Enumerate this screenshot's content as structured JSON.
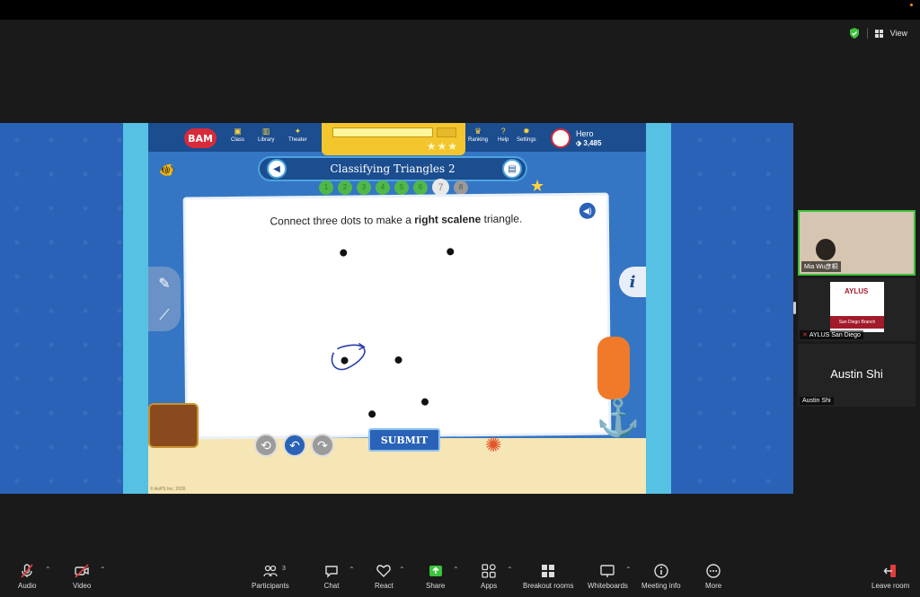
{
  "window": {
    "view_label": "View"
  },
  "game": {
    "logo": "BAM",
    "nav": [
      {
        "label": "Class",
        "icon": "class-icon"
      },
      {
        "label": "Library",
        "icon": "library-icon"
      },
      {
        "label": "Theater",
        "icon": "theater-icon"
      },
      {
        "label": "Ranking",
        "icon": "ranking-icon"
      },
      {
        "label": "Help",
        "icon": "help-icon"
      },
      {
        "label": "Settings",
        "icon": "settings-icon"
      }
    ],
    "hero_name": "Hero",
    "hero_coins": "3,485",
    "lesson_title": "Classifying Triangles 2",
    "steps": [
      "1",
      "2",
      "3",
      "4",
      "5",
      "6",
      "7",
      "8"
    ],
    "current_step": "7",
    "prompt_pre": "Connect three dots to make a ",
    "prompt_bold": "right scalene",
    "prompt_post": " triangle.",
    "submit_label": "SUBMIT",
    "copyright": "© AoPS Inc. 2026"
  },
  "participants": [
    {
      "name": "Mia  Wu彦桐",
      "muted": false
    },
    {
      "name": "AYLUS San Diego",
      "muted": true,
      "logo_title": "AYLUS",
      "logo_band": "San Diego Branch"
    },
    {
      "name": "Austin Shi",
      "display": "Austin Shi",
      "muted": false
    }
  ],
  "toolbar": {
    "audio": "Audio",
    "video": "Video",
    "participants": "Participants",
    "participants_count": "3",
    "chat": "Chat",
    "react": "React",
    "share": "Share",
    "apps": "Apps",
    "breakout": "Breakout rooms",
    "whiteboards": "Whiteboards",
    "meeting_info": "Meeting info",
    "more": "More",
    "leave": "Leave room"
  },
  "colors": {
    "share_green": "#3cc23c",
    "accent_blue": "#2a62b8",
    "alert_red": "#e23b3b"
  }
}
